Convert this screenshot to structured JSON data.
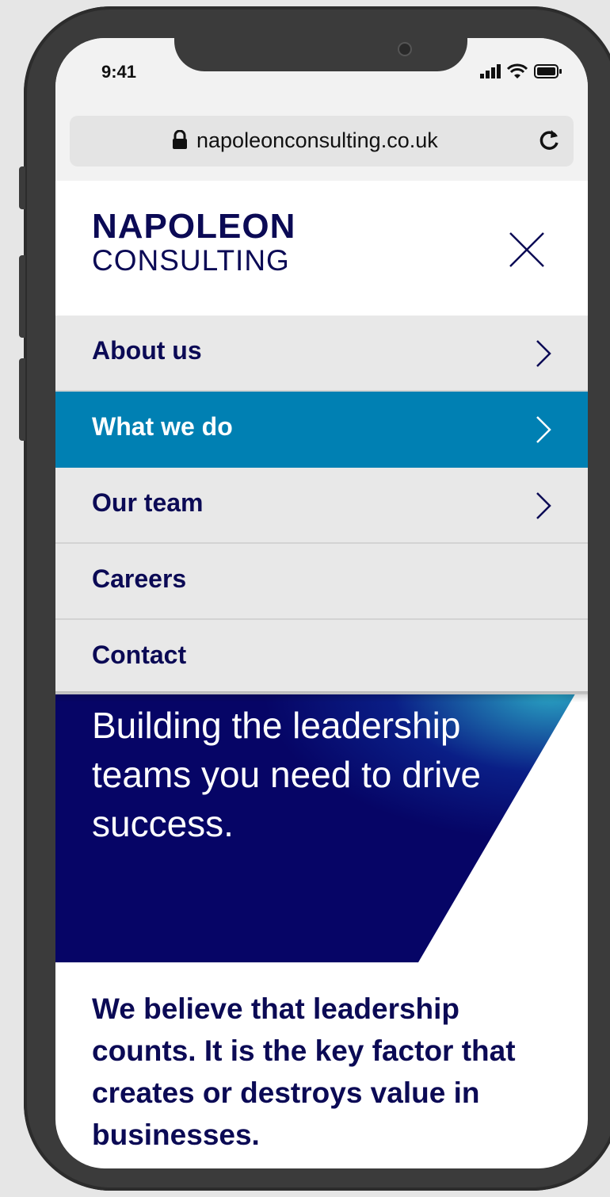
{
  "status": {
    "time": "9:41"
  },
  "browser": {
    "url": "napoleonconsulting.co.uk"
  },
  "logo": {
    "line1": "NAPOLEON",
    "line2": "CONSULTING"
  },
  "menu": {
    "items": [
      {
        "label": "About us"
      },
      {
        "label": "What we do"
      },
      {
        "label": "Our team"
      },
      {
        "label": "Careers"
      },
      {
        "label": "Contact"
      }
    ],
    "active_index": 1
  },
  "hero": {
    "headline": "Building the leadership teams you need to drive success."
  },
  "intro": {
    "text": "We believe that leadership counts. It is the key factor that creates or destroys value in businesses."
  },
  "colors": {
    "brand_navy": "#0b0a55",
    "active_blue": "#0080b3",
    "menu_bg": "#e8e8e8",
    "hero_navy": "#060566",
    "hero_teal": "#2aa6c4"
  },
  "icons": [
    "lock-icon",
    "reload-icon",
    "signal-icon",
    "wifi-icon",
    "battery-icon",
    "close-icon",
    "chevron-right-icon"
  ]
}
